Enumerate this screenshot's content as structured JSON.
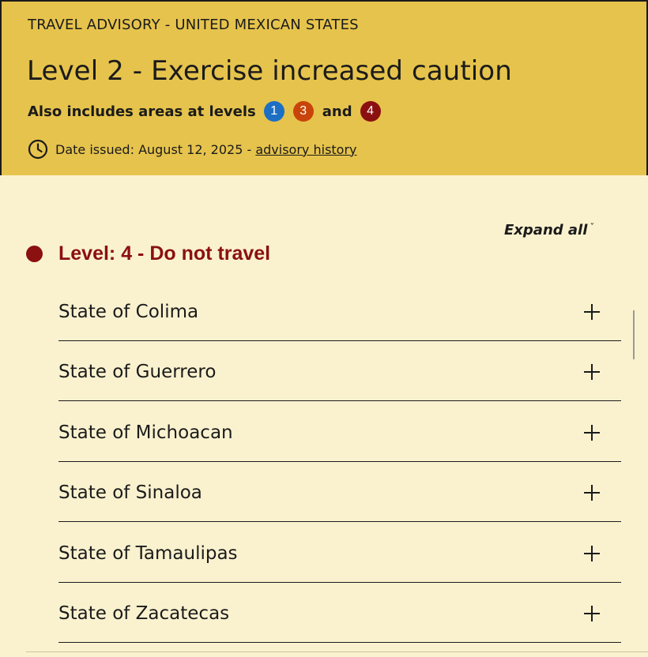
{
  "header": {
    "kicker": "TRAVEL ADVISORY - UNITED MEXICAN STATES",
    "title": "Level 2 - Exercise increased caution",
    "also_includes": "Also includes areas at levels",
    "levels": [
      "1",
      "3",
      "4"
    ],
    "and": "and",
    "date_issued": "Date issued: August 12, 2025 - ",
    "history_link": "advisory history"
  },
  "expand_all": "Expand all",
  "expand_chevron": "ˇ",
  "level_section": {
    "label": "Level: 4 - Do not travel",
    "states": [
      "State of Colima",
      "State of Guerrero",
      "State of Michoacan",
      "State of Sinaloa",
      "State of Tamaulipas",
      "State of Zacatecas"
    ]
  },
  "colors": {
    "header_bg": "#e6c34c",
    "page_bg": "#faf2cf",
    "level1": "#1d6fc4",
    "level3": "#c8440a",
    "level4": "#8b1010"
  }
}
